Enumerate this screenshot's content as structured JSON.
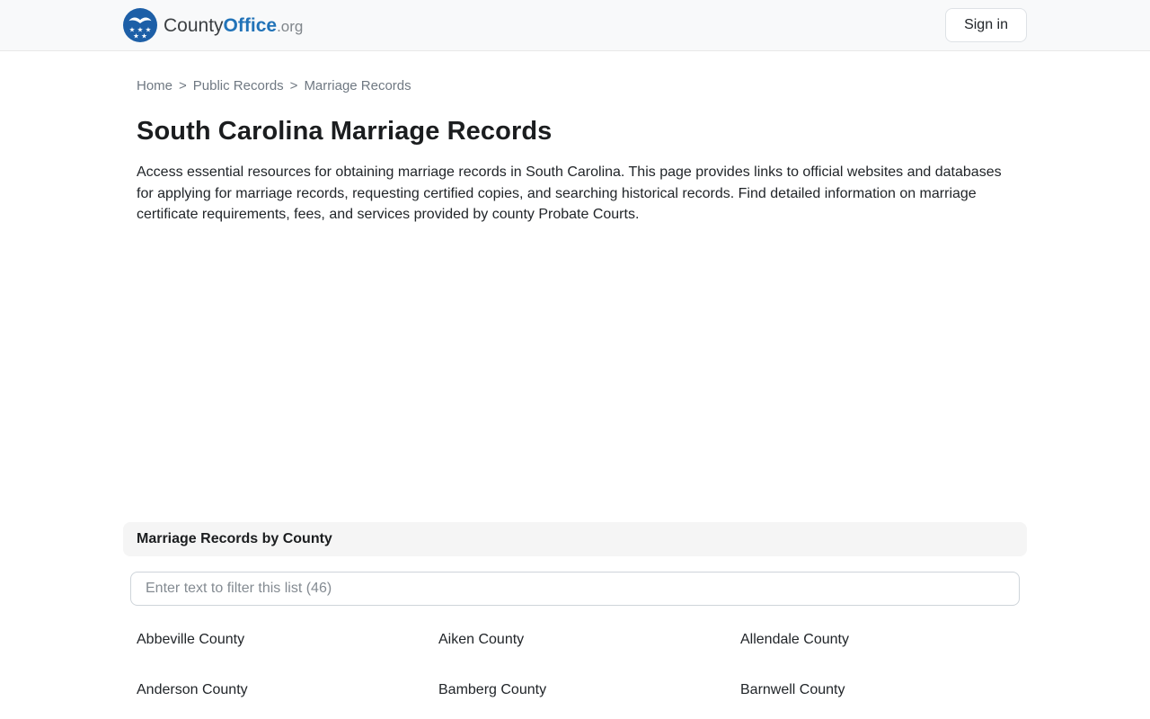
{
  "header": {
    "logo": {
      "county": "County",
      "office": "Office",
      "org": ".org"
    },
    "sign_in_label": "Sign in"
  },
  "breadcrumb": {
    "separator": ">",
    "items": [
      {
        "label": "Home"
      },
      {
        "label": "Public Records"
      },
      {
        "label": "Marriage Records"
      }
    ]
  },
  "page": {
    "title": "South Carolina Marriage Records",
    "description": "Access essential resources for obtaining marriage records in South Carolina. This page provides links to official websites and databases for applying for marriage records, requesting certified copies, and searching historical records. Find detailed information on marriage certificate requirements, fees, and services provided by county Probate Courts."
  },
  "county_section": {
    "heading": "Marriage Records by County",
    "filter_placeholder": "Enter text to filter this list (46)",
    "county_count": "46",
    "counties": [
      "Abbeville County",
      "Aiken County",
      "Allendale County",
      "Anderson County",
      "Bamberg County",
      "Barnwell County"
    ]
  },
  "colors": {
    "header_bg": "#f8f9fa",
    "logo_circle_blue": "#1d5fa7",
    "logo_office_blue": "#2273b8",
    "breadcrumb_gray": "#6f7882",
    "text_dark": "#212529",
    "section_header_bg": "#f5f5f5",
    "input_border": "#ced4da"
  }
}
